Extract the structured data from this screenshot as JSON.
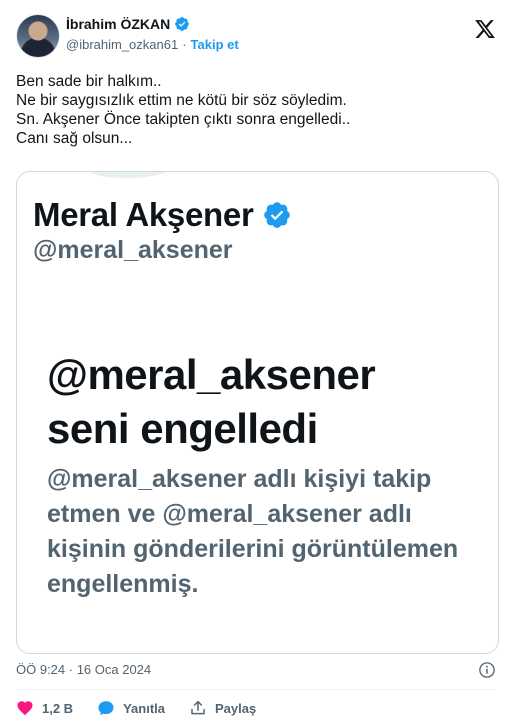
{
  "author": {
    "name": "İbrahim ÖZKAN",
    "handle": "@ibrahim_ozkan61",
    "separator": "·",
    "follow_label": "Takip et"
  },
  "tweet": {
    "lines": [
      "Ben sade bir halkım..",
      "Ne bir saygısızlık ettim ne kötü bir söz söyledim.",
      "Sn. Akşener Önce takipten çıktı sonra engelledi..",
      "Canı sağ olsun..."
    ]
  },
  "media": {
    "profile_name": "Meral Akşener",
    "profile_handle": "@meral_aksener",
    "blocked_title_line1": "@meral_aksener",
    "blocked_title_line2": "seni engelledi",
    "blocked_description": "@meral_aksener adlı kişiyi takip etmen ve @meral_aksener adlı kişinin gönderilerini görüntülemen engellenmiş."
  },
  "meta": {
    "timestamp": "ÖÖ 9:24 · 16 Oca 2024"
  },
  "actions": {
    "like_count": "1,2 B",
    "reply_label": "Yanıtla",
    "share_label": "Paylaş"
  },
  "colors": {
    "accent": "#1d9bf0",
    "like": "#f91880",
    "text": "#0f1419",
    "muted": "#536471"
  },
  "icons": {
    "verified": "verified-badge-icon",
    "logo": "x-logo-icon",
    "info": "info-icon",
    "like": "heart-icon",
    "reply": "reply-bubble-icon",
    "share": "share-icon"
  }
}
